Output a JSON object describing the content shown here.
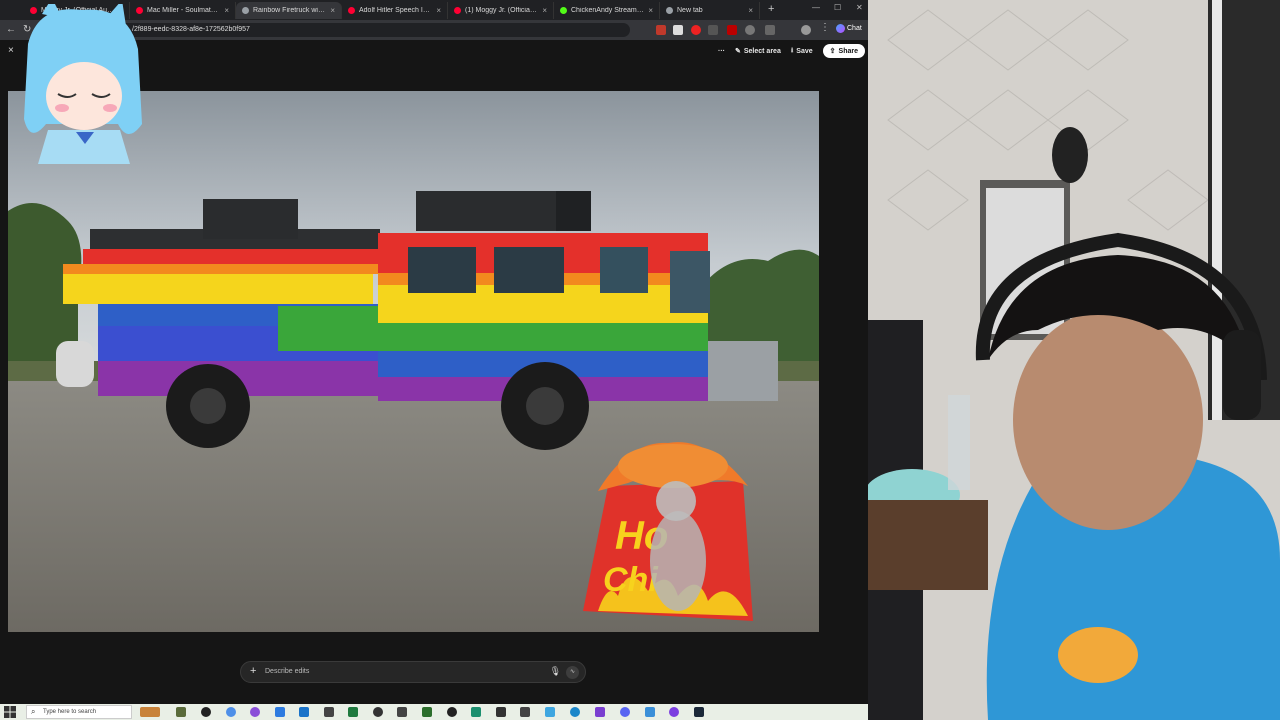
{
  "browser": {
    "tabs": [
      {
        "label": "Moggy Jr. (Official Audio) - Y",
        "favicon_color": "#ff0033"
      },
      {
        "label": "Mac Miller - Soulmate - YouT",
        "favicon_color": "#ff0033"
      },
      {
        "label": "Rainbow Firetruck with Chips",
        "favicon_color": "#9aa0a6",
        "active": true
      },
      {
        "label": "Adolf Hitler Speech In English",
        "favicon_color": "#ff0033"
      },
      {
        "label": "(1) Moggy Jr. (Official Audio)",
        "favicon_color": "#ff0033"
      },
      {
        "label": "ChickenAndy Stream - V",
        "favicon_color": "#53fc18"
      },
      {
        "label": "New tab",
        "favicon_color": "#9aa0a6"
      }
    ],
    "new_tab_symbol": "+",
    "url": "/2f889-eedc-8328-af8e-172562b0f957",
    "chat_label": "Chat"
  },
  "viewer": {
    "close_symbol": "×",
    "more_symbol": "···",
    "select_area_label": "Select area",
    "save_label": "Save",
    "share_label": "Share",
    "image_subject": "rainbow-firetruck-with-hot-chips-bag",
    "chips_text_line1": "Ho",
    "chips_text_line2": "Chi",
    "edit_placeholder": "Describe edits",
    "edit_plus": "+"
  },
  "taskbar": {
    "search_placeholder": "Type here to search"
  },
  "colors": {
    "accent": "#ff0033",
    "rainbow": [
      "#e4302b",
      "#f28a1e",
      "#f5d51c",
      "#3aa63a",
      "#2e5fc7",
      "#8a34a8"
    ]
  }
}
